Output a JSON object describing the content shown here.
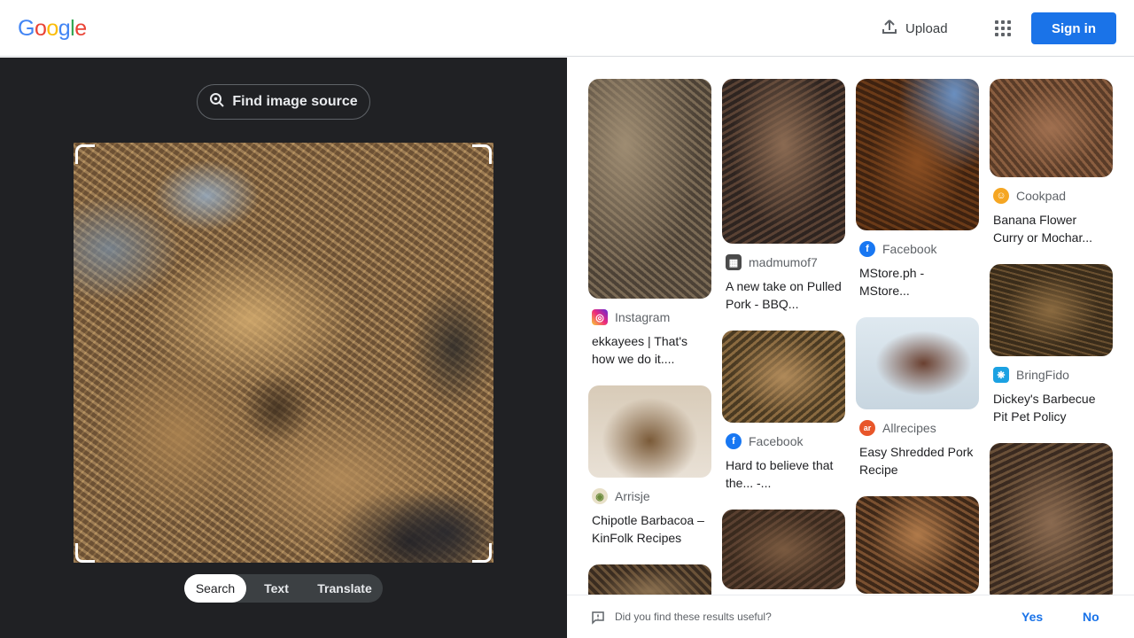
{
  "header": {
    "logo_letters": [
      "G",
      "o",
      "o",
      "g",
      "l",
      "e"
    ],
    "logo_colors": [
      "#4285f4",
      "#ea4335",
      "#fbbc05",
      "#4285f4",
      "#34a853",
      "#ea4335"
    ],
    "upload_label": "Upload",
    "apps_icon": "apps-grid-icon",
    "signin_label": "Sign in"
  },
  "lens": {
    "find_source_label": "Find image source",
    "modes": [
      "Search",
      "Text",
      "Translate"
    ],
    "active_mode": "Search"
  },
  "results": {
    "col1": [
      {
        "source": "Instagram",
        "title": "ekkayees | That's how we do it....",
        "icon": "instagram-icon"
      },
      {
        "source": "Arrisje",
        "title": "Chipotle Barbacoa – KinFolk Recipes",
        "icon": "arrisje-icon"
      }
    ],
    "col2": [
      {
        "source": "madmumof7",
        "title": "A new take on Pulled Pork - BBQ...",
        "icon": "madmumof7-icon"
      },
      {
        "source": "Facebook",
        "title": "Hard to believe that the... -...",
        "icon": "facebook-icon"
      }
    ],
    "col3": [
      {
        "source": "Facebook",
        "title": "MStore.ph - MStore...",
        "icon": "facebook-icon"
      },
      {
        "source": "Allrecipes",
        "title": "Easy Shredded Pork Recipe",
        "icon": "allrecipes-icon"
      }
    ],
    "col4": [
      {
        "source": "Cookpad",
        "title": "Banana Flower Curry or Mochar...",
        "icon": "cookpad-icon"
      },
      {
        "source": "BringFido",
        "title": "Dickey's Barbecue Pit Pet Policy",
        "icon": "bringfido-icon"
      }
    ]
  },
  "feedback": {
    "question": "Did you find these results useful?",
    "yes_label": "Yes",
    "no_label": "No"
  },
  "colors": {
    "accent": "#1a73e8",
    "dark_panel": "#202124",
    "facebook": "#1877f2",
    "instagram": "#e1306c",
    "cookpad": "#f5a623",
    "allrecipes": "#e8562a",
    "bringfido": "#1ba1e2"
  }
}
